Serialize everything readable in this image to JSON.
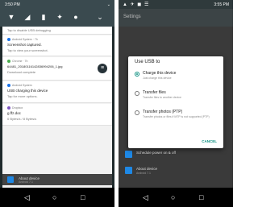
{
  "left": {
    "status": {
      "time": "3:50 PM"
    },
    "notifications": [
      {
        "app": "",
        "title": "",
        "sub": "Tap to disable USB debugging"
      },
      {
        "app": "Android System · 7h",
        "title": "Screenshot captured.",
        "sub": "Tap to view your screenshot."
      },
      {
        "app": "Chrome · 7h",
        "title": "64481_20180116142836994206_1.jpg",
        "sub": "Download complete"
      },
      {
        "app": "Android System",
        "title": "USB charging this device",
        "sub": "Tap for more options."
      },
      {
        "app": "Dropbox",
        "title": "g.ffz.doc",
        "sub": "0 Bytes/s / 8 Bytes/s"
      }
    ],
    "clear_all": "CLEAR ALL",
    "dim_items": [
      {
        "title": "About device",
        "sub": "Android 7.1"
      }
    ]
  },
  "right": {
    "status": {
      "time": "3:55 PM"
    },
    "settings_title": "Settings",
    "dialog": {
      "title": "Use USB to",
      "options": [
        {
          "label": "Charge this device",
          "desc": "Just charge this device",
          "selected": true
        },
        {
          "label": "Transfer files",
          "desc": "Transfer files to another device",
          "selected": false
        },
        {
          "label": "Transfer photos (PTP)",
          "desc": "Transfer photos or files if MTP is not supported (PTP)",
          "selected": false
        }
      ],
      "cancel": "CANCEL"
    },
    "settings_rows": [
      {
        "title": "Schedule power on & off",
        "sub": ""
      },
      {
        "title": "About device",
        "sub": "Android 7.1"
      }
    ]
  },
  "colors": {
    "accent": "#0b8e80",
    "icon_blue": "#1e88e5"
  }
}
